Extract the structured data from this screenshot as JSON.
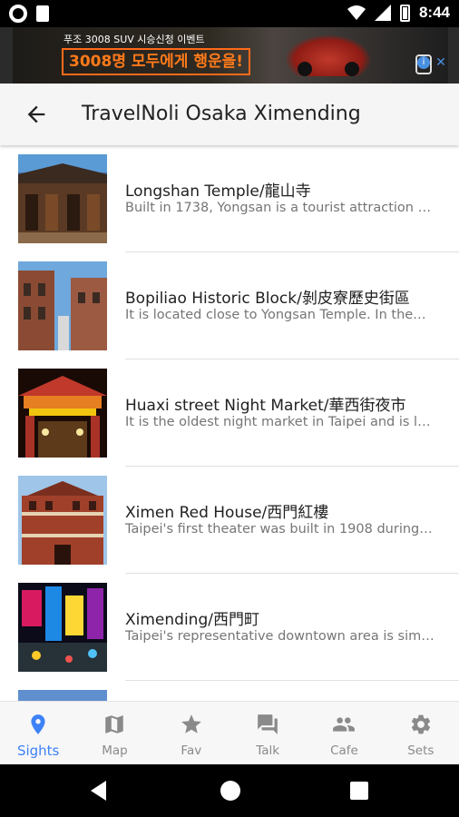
{
  "status_bar": {
    "time": "8:44"
  },
  "ad": {
    "line1": "푸조 3008 SUV 시승신청 이벤트",
    "line2": "3008명 모두에게 행운을!",
    "choices_label": "i",
    "close_label": "✕"
  },
  "app_bar": {
    "title": "TravelNoli Osaka Ximending"
  },
  "sights": [
    {
      "title": "Longshan Temple/龍山寺",
      "description": "Built in 1738, Yongsan is a tourist attraction …"
    },
    {
      "title": "Bopiliao Historic Block/剝皮寮歷史街區",
      "description": "It is located close to Yongsan Temple. In the…"
    },
    {
      "title": "Huaxi street Night Market/華西街夜市",
      "description": "It is the oldest night market in Taipei and is l…"
    },
    {
      "title": "Ximen Red House/西門紅樓",
      "description": "Taipei's first theater was built in 1908 during…"
    },
    {
      "title": "Ximending/西門町",
      "description": "Taipei's representative downtown area is sim…"
    }
  ],
  "bottom_nav": {
    "items": [
      {
        "label": "Sights",
        "icon": "location-pin-icon"
      },
      {
        "label": "Map",
        "icon": "map-icon"
      },
      {
        "label": "Fav",
        "icon": "star-icon"
      },
      {
        "label": "Talk",
        "icon": "chat-icon"
      },
      {
        "label": "Cafe",
        "icon": "people-icon"
      },
      {
        "label": "Sets",
        "icon": "gear-icon"
      }
    ],
    "active_index": 0
  },
  "colors": {
    "accent": "#3e82f7",
    "inactive": "#8a8a8a",
    "title_text": "#212121",
    "secondary_text": "#757575"
  }
}
